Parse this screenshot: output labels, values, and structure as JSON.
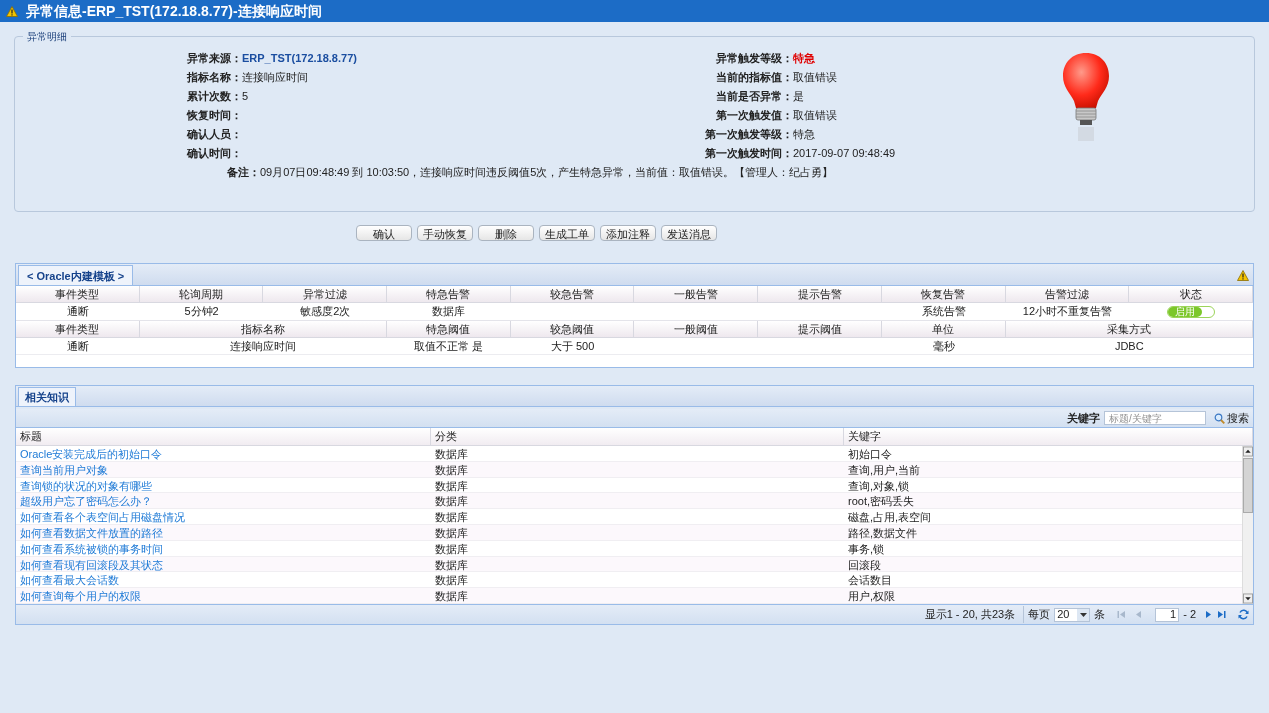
{
  "window": {
    "title": "异常信息-ERP_TST(172.18.8.77)-连接响应时间"
  },
  "details": {
    "legend": "异常明细",
    "left": [
      {
        "label": "异常来源：",
        "value": "ERP_TST(172.18.8.77)",
        "kind": "link"
      },
      {
        "label": "指标名称：",
        "value": "连接响应时间",
        "kind": "text"
      },
      {
        "label": "累计次数：",
        "value": "5",
        "kind": "text"
      },
      {
        "label": "恢复时间："
      },
      {
        "label": "确认人员："
      },
      {
        "label": "确认时间："
      }
    ],
    "right": [
      {
        "label": "异常触发等级：",
        "value": "特急",
        "kind": "alert"
      },
      {
        "label": "当前的指标值：",
        "value": "取值错误",
        "kind": "text"
      },
      {
        "label": "当前是否异常：",
        "value": "是",
        "kind": "text"
      },
      {
        "label": "第一次触发值：",
        "value": "取值错误",
        "kind": "text"
      },
      {
        "label": "第一次触发等级：",
        "value": "特急",
        "kind": "text"
      },
      {
        "label": "第一次触发时间：",
        "value": "2017-09-07 09:48:49",
        "kind": "text"
      }
    ],
    "note": {
      "label": "备注：",
      "value": "09月07日09:48:49 到 10:03:50，连接响应时间违反阈值5次，产生特急异常，当前值：取值错误。【管理人：纪占勇】"
    }
  },
  "buttons": [
    "确认",
    "手动恢复",
    "删除",
    "生成工单",
    "添加注释",
    "发送消息"
  ],
  "template": {
    "tab": "< Oracle内建模板 >",
    "alarm_table": {
      "columns": [
        "事件类型",
        "轮询周期",
        "异常过滤",
        "特急告警",
        "较急告警",
        "一般告警",
        "提示告警",
        "恢复告警",
        "告警过滤",
        "状态"
      ],
      "row": [
        {
          "kind": "text",
          "text": "通断"
        },
        {
          "kind": "text",
          "text": "5分钟2"
        },
        {
          "kind": "text",
          "text": "敏感度2次"
        },
        {
          "kind": "text",
          "text": "数据库"
        },
        {
          "kind": "blank"
        },
        {
          "kind": "blank"
        },
        {
          "kind": "blank"
        },
        {
          "kind": "text",
          "text": "系统告警"
        },
        {
          "kind": "text",
          "text": "12小时不重复告警"
        }
      ],
      "status": {
        "label": "启用",
        "on": true
      }
    },
    "threshold_table": {
      "columns": [
        "事件类型",
        "指标名称",
        "特急阈值",
        "较急阈值",
        "一般阈值",
        "提示阈值",
        "单位",
        "采集方式"
      ],
      "row": [
        {
          "kind": "text",
          "text": "通断"
        },
        {
          "kind": "text",
          "text": "连接响应时间"
        },
        {
          "kind": "text",
          "text": "取值不正常 是"
        },
        {
          "kind": "text",
          "text": "大于 500"
        },
        {
          "kind": "blank"
        },
        {
          "kind": "blank"
        },
        {
          "kind": "text",
          "text": "毫秒"
        },
        {
          "kind": "text",
          "text": "JDBC"
        }
      ]
    }
  },
  "knowledge": {
    "tab": "相关知识",
    "keyword_label": "关键字",
    "search": {
      "placeholder": "标题/关键字"
    },
    "search_button": "搜索",
    "columns": [
      "标题",
      "分类",
      "关键字"
    ],
    "rows": [
      [
        "Oracle安装完成后的初始口令",
        "数据库",
        "初始口令"
      ],
      [
        "查询当前用户对象",
        "数据库",
        "查询,用户,当前"
      ],
      [
        "查询锁的状况的对象有哪些",
        "数据库",
        "查询,对象,锁"
      ],
      [
        "超级用户忘了密码怎么办？",
        "数据库",
        "root,密码丢失"
      ],
      [
        "如何查看各个表空间占用磁盘情况",
        "数据库",
        "磁盘,占用,表空间"
      ],
      [
        "如何查看数据文件放置的路径",
        "数据库",
        "路径,数据文件"
      ],
      [
        "如何查看系统被锁的事务时间",
        "数据库",
        "事务,锁"
      ],
      [
        "如何查看现有回滚段及其状态",
        "数据库",
        "回滚段"
      ],
      [
        "如何查看最大会话数",
        "数据库",
        "会话数目"
      ],
      [
        "如何查询每个用户的权限",
        "数据库",
        "用户,权限"
      ]
    ],
    "pager": {
      "summary": "显示1 - 20, 共23条",
      "per_page_label": "每页",
      "per_page": "20",
      "unit": "条",
      "page": "1",
      "total": "- 2"
    }
  }
}
